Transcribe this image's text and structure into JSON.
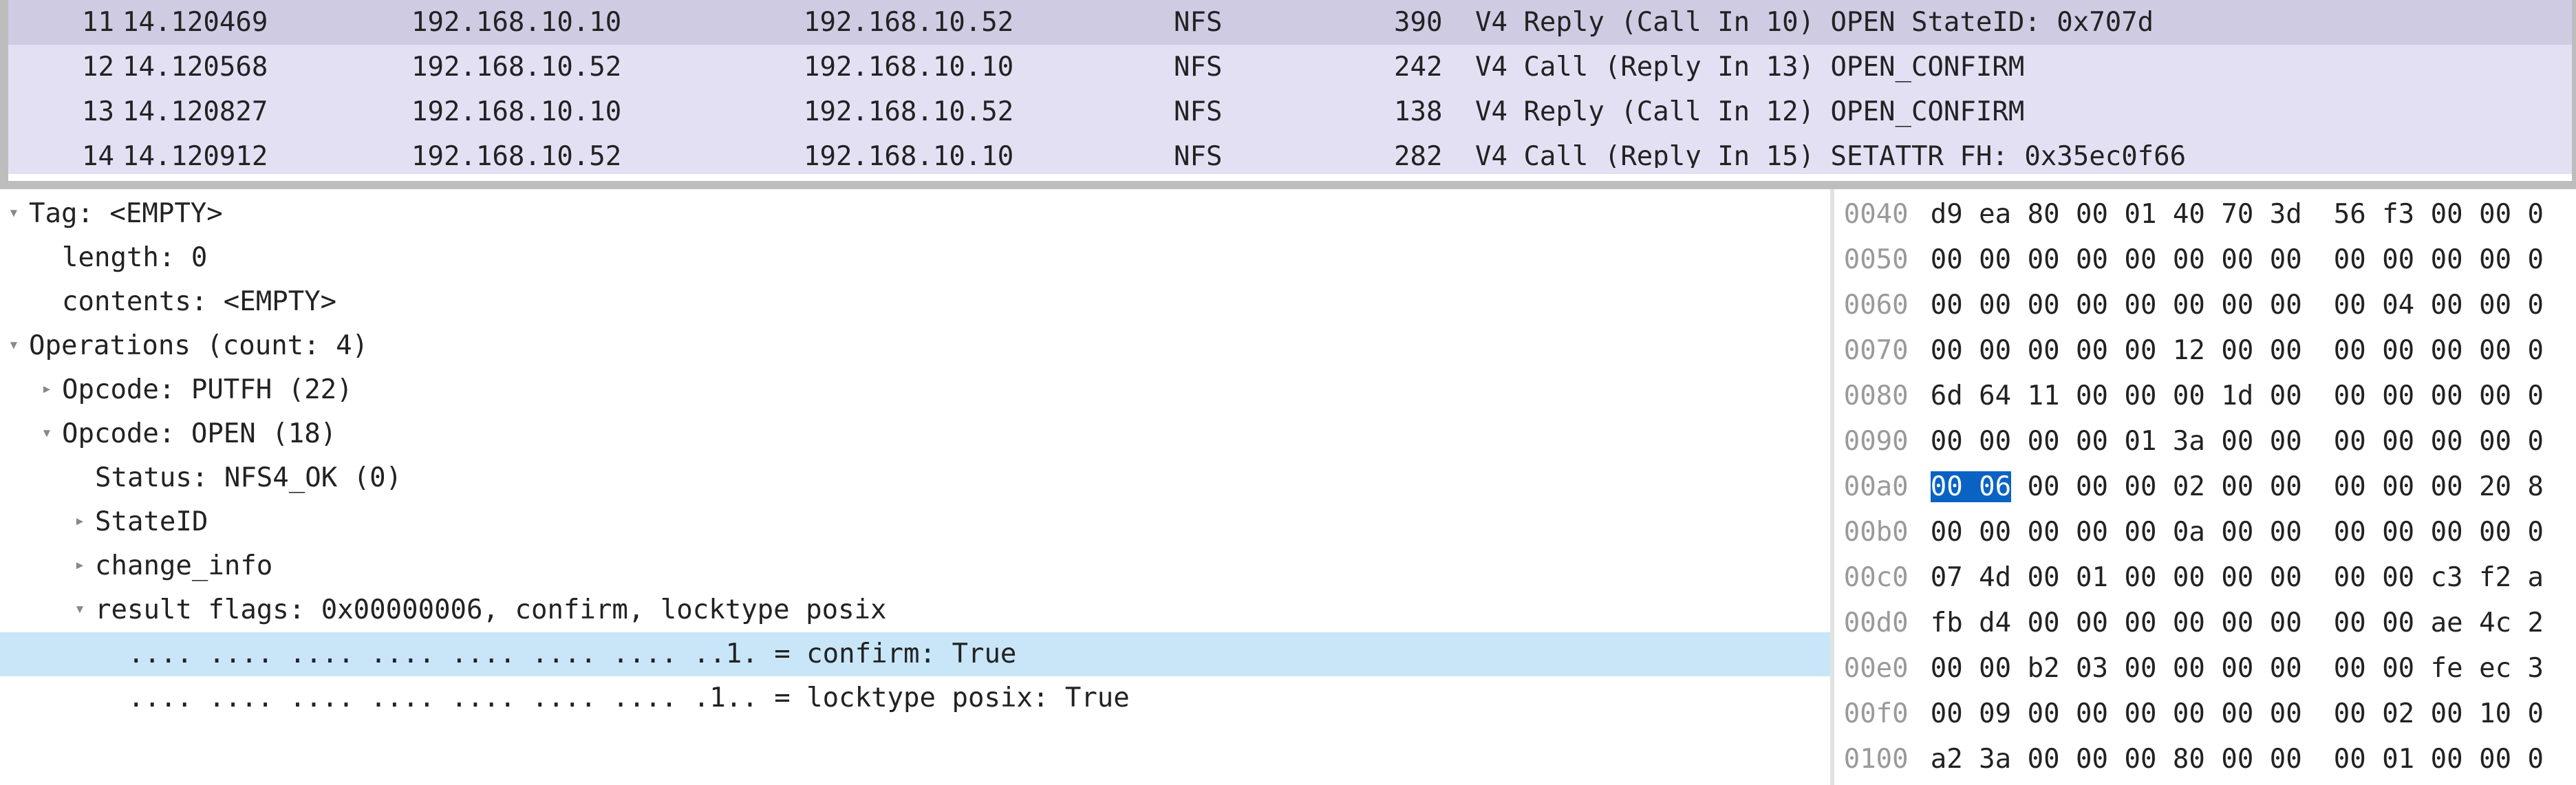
{
  "packets": [
    {
      "num": "11",
      "time": "14.120469",
      "src": "192.168.10.10",
      "dst": "192.168.10.52",
      "proto": "NFS",
      "len": "390",
      "info": "V4 Reply (Call In 10) OPEN StateID: 0x707d",
      "selected": true
    },
    {
      "num": "12",
      "time": "14.120568",
      "src": "192.168.10.52",
      "dst": "192.168.10.10",
      "proto": "NFS",
      "len": "242",
      "info": "V4 Call (Reply In 13) OPEN_CONFIRM"
    },
    {
      "num": "13",
      "time": "14.120827",
      "src": "192.168.10.10",
      "dst": "192.168.10.52",
      "proto": "NFS",
      "len": "138",
      "info": "V4 Reply (Call In 12) OPEN_CONFIRM"
    },
    {
      "num": "14",
      "time": "14.120912",
      "src": "192.168.10.52",
      "dst": "192.168.10.10",
      "proto": "NFS",
      "len": "282",
      "info": "V4 Call (Reply In 15) SETATTR FH: 0x35ec0f66",
      "cut": true
    }
  ],
  "tree": [
    {
      "depth": 0,
      "twist": "open",
      "txt": "Tag: <EMPTY>"
    },
    {
      "depth": 1,
      "twist": "none",
      "txt": "length: 0"
    },
    {
      "depth": 1,
      "twist": "none",
      "txt": "contents: <EMPTY>"
    },
    {
      "depth": 0,
      "twist": "open",
      "txt": "Operations (count: 4)"
    },
    {
      "depth": 1,
      "twist": "closed",
      "txt": "Opcode: PUTFH (22)"
    },
    {
      "depth": 1,
      "twist": "open",
      "txt": "Opcode: OPEN (18)"
    },
    {
      "depth": 2,
      "twist": "none",
      "txt": "Status: NFS4_OK (0)"
    },
    {
      "depth": 2,
      "twist": "closed",
      "txt": "StateID"
    },
    {
      "depth": 2,
      "twist": "closed",
      "txt": "change_info"
    },
    {
      "depth": 2,
      "twist": "open",
      "txt": "result flags: 0x00000006, confirm, locktype posix"
    },
    {
      "depth": 3,
      "twist": "none",
      "txt": ".... .... .... .... .... .... .... ..1. = confirm: True",
      "selected": true
    },
    {
      "depth": 3,
      "twist": "none",
      "txt": ".... .... .... .... .... .... .... .1.. = locktype posix: True"
    }
  ],
  "hex": [
    {
      "off": "0040",
      "a": "d9 ea 80 00 01 40 70 3d",
      "b": "56 f3 00 00 0"
    },
    {
      "off": "0050",
      "a": "00 00 00 00 00 00 00 00",
      "b": "00 00 00 00 0"
    },
    {
      "off": "0060",
      "a": "00 00 00 00 00 00 00 00",
      "b": "00 04 00 00 0"
    },
    {
      "off": "0070",
      "a": "00 00 00 00 00 12 00 00",
      "b": "00 00 00 00 0"
    },
    {
      "off": "0080",
      "a": "6d 64 11 00 00 00 1d 00",
      "b": "00 00 00 00 0"
    },
    {
      "off": "0090",
      "a": "00 00 00 00 01 3a 00 00",
      "b": "00 00 00 00 0"
    },
    {
      "off": "00a0",
      "a_hl": "00 06",
      "a_rest": " 00 00 00 02 00 00",
      "b": "00 00 00 20 8"
    },
    {
      "off": "00b0",
      "a": "00 00 00 00 00 0a 00 00",
      "b": "00 00 00 00 0"
    },
    {
      "off": "00c0",
      "a": "07 4d 00 01 00 00 00 00",
      "b": "00 00 c3 f2 a"
    },
    {
      "off": "00d0",
      "a": "fb d4 00 00 00 00 00 00",
      "b": "00 00 ae 4c 2"
    },
    {
      "off": "00e0",
      "a": "00 00 b2 03 00 00 00 00",
      "b": "00 00 fe ec 3"
    },
    {
      "off": "00f0",
      "a": "00 09 00 00 00 00 00 00",
      "b": "00 02 00 10 0"
    },
    {
      "off": "0100",
      "a": "a2 3a 00 00 00 80 00 00",
      "b": "00 01 00 00 0"
    }
  ]
}
